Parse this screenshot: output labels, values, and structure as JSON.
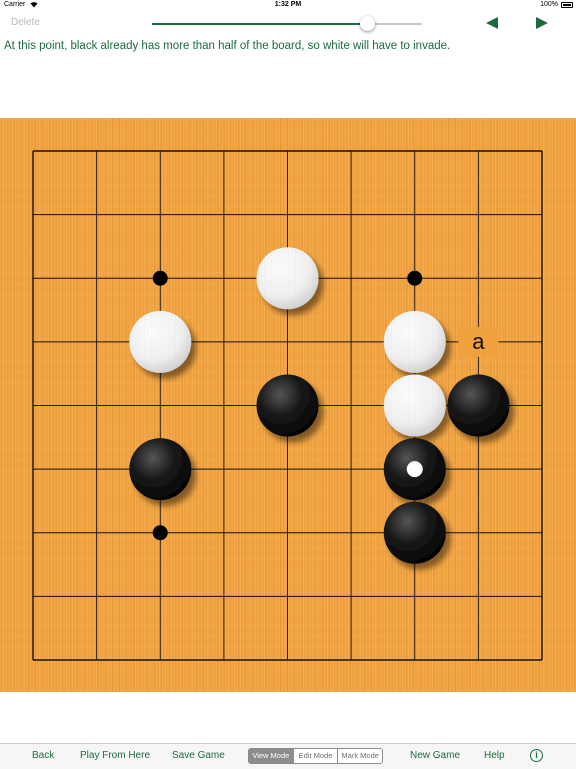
{
  "status_bar": {
    "carrier": "Carrier",
    "wifi_icon": "wifi-icon",
    "time": "1:32 PM",
    "battery_percent": "100%",
    "battery_icon": "battery-icon"
  },
  "toolbar": {
    "delete_label": "Delete",
    "slider_value": 0.8,
    "prev_icon": "left-triangle-icon",
    "next_icon": "right-triangle-icon",
    "accent_color": "#1b6b3e"
  },
  "comment": "At this point, black already has more than half of the board, so white will have to invade.",
  "board": {
    "size": 9,
    "color": "#f0a13d",
    "star_points": [
      [
        2,
        2
      ],
      [
        6,
        2
      ],
      [
        2,
        6
      ]
    ],
    "stones": [
      {
        "color": "white",
        "col": 4,
        "row": 2
      },
      {
        "color": "white",
        "col": 2,
        "row": 3
      },
      {
        "color": "white",
        "col": 6,
        "row": 3
      },
      {
        "color": "black",
        "col": 4,
        "row": 4
      },
      {
        "color": "white",
        "col": 6,
        "row": 4
      },
      {
        "color": "black",
        "col": 7,
        "row": 4
      },
      {
        "color": "black",
        "col": 2,
        "row": 5
      },
      {
        "color": "black",
        "col": 6,
        "row": 5,
        "last_move": true
      },
      {
        "color": "black",
        "col": 6,
        "row": 6
      }
    ],
    "labels": [
      {
        "text": "a",
        "col": 7,
        "row": 3
      }
    ]
  },
  "bottom_bar": {
    "back": "Back",
    "play_from_here": "Play From Here",
    "save_game": "Save Game",
    "modes": [
      "View Mode",
      "Edit Mode",
      "Mark Mode"
    ],
    "selected_mode": 0,
    "new_game": "New Game",
    "help": "Help",
    "info_icon": "info-icon",
    "info_glyph": "i"
  }
}
